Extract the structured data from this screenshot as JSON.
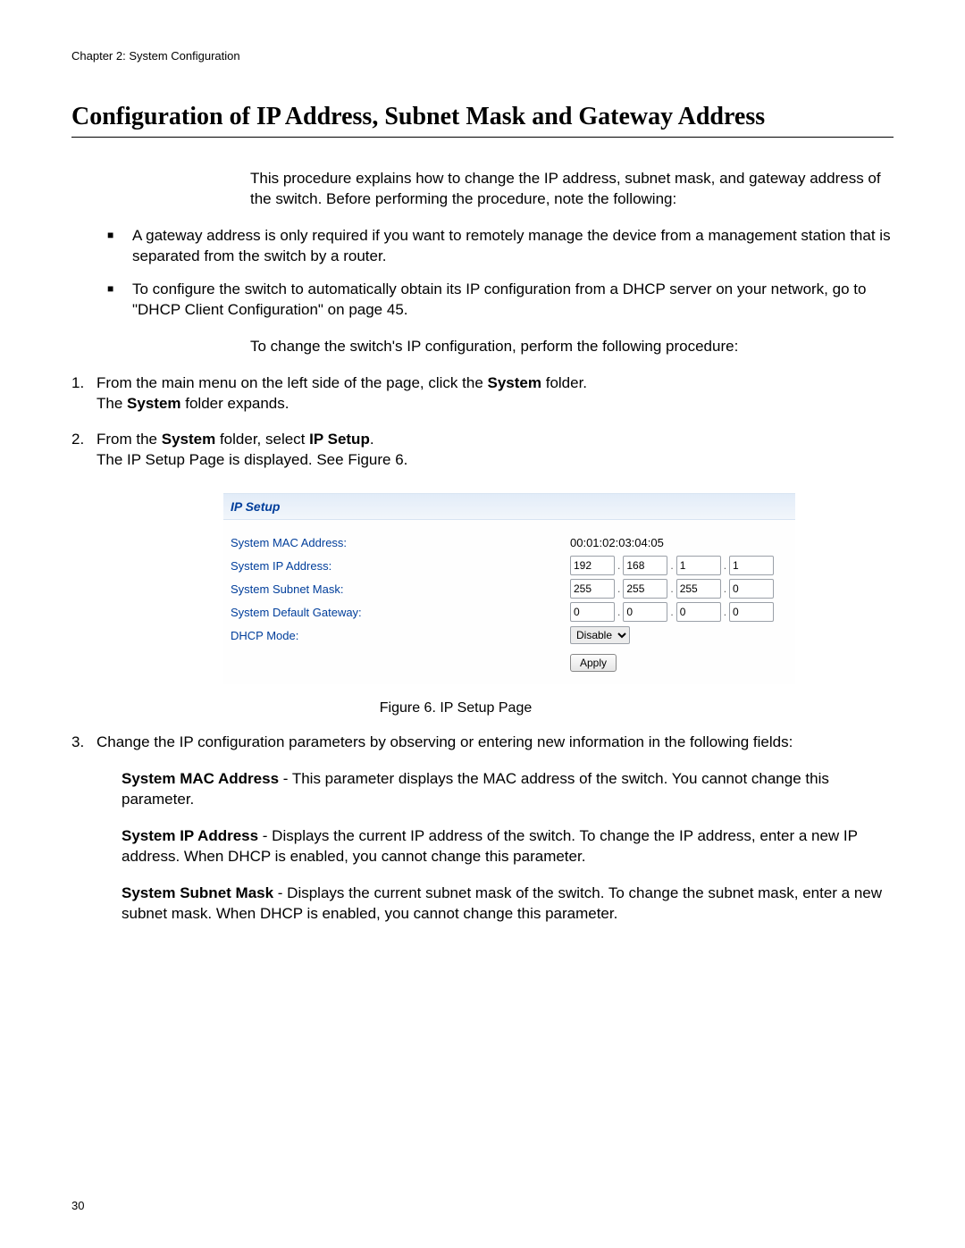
{
  "chapter_header": "Chapter 2: System Configuration",
  "page_title": "Configuration of IP Address, Subnet Mask and Gateway Address",
  "intro": "This procedure explains how to change the IP address, subnet mask, and gateway address of the switch. Before performing the procedure, note the following:",
  "bullets": [
    "A gateway address is only required if you want to remotely manage the device from a management station that is separated from the switch by a router.",
    "To configure the switch to automatically obtain its IP configuration from a DHCP server on your network, go to \"DHCP Client Configuration\" on page 45."
  ],
  "lead_in": "To change the switch's IP configuration, perform the following procedure:",
  "steps": {
    "s1_a": "From the main menu on the left side of the page, click the ",
    "s1_b_bold": "System",
    "s1_c": " folder.",
    "s1_d": "The ",
    "s1_e_bold": "System",
    "s1_f": " folder expands.",
    "s2_a": "From the ",
    "s2_b_bold": "System",
    "s2_c": " folder, select ",
    "s2_d_bold": "IP Setup",
    "s2_e": ".",
    "s2_f": "The IP Setup Page is displayed. See Figure 6.",
    "s3": "Change the IP configuration parameters by observing or entering new information in the following fields:"
  },
  "ip_setup": {
    "header": "IP Setup",
    "labels": {
      "mac": "System MAC Address:",
      "ip": "System IP Address:",
      "mask": "System Subnet Mask:",
      "gw": "System Default Gateway:",
      "dhcp": "DHCP Mode:"
    },
    "mac_value": "00:01:02:03:04:05",
    "ip_octets": [
      "192",
      "168",
      "1",
      "1"
    ],
    "mask_octets": [
      "255",
      "255",
      "255",
      "0"
    ],
    "gw_octets": [
      "0",
      "0",
      "0",
      "0"
    ],
    "dhcp_value": "Disable",
    "apply_label": "Apply"
  },
  "figure_caption": "Figure 6. IP Setup Page",
  "defs": {
    "mac_bold": "System MAC Address",
    "mac_text": " - This parameter displays the MAC address of the switch. You cannot change this parameter.",
    "ip_bold": "System IP Address",
    "ip_text": " - Displays the current IP address of the switch. To change the IP address, enter a new IP address. When DHCP is enabled, you cannot change this parameter.",
    "mask_bold": "System Subnet Mask",
    "mask_text": " - Displays the current subnet mask of the switch. To change the subnet mask, enter a new subnet mask. When DHCP is enabled, you cannot change this parameter."
  },
  "page_number": "30"
}
